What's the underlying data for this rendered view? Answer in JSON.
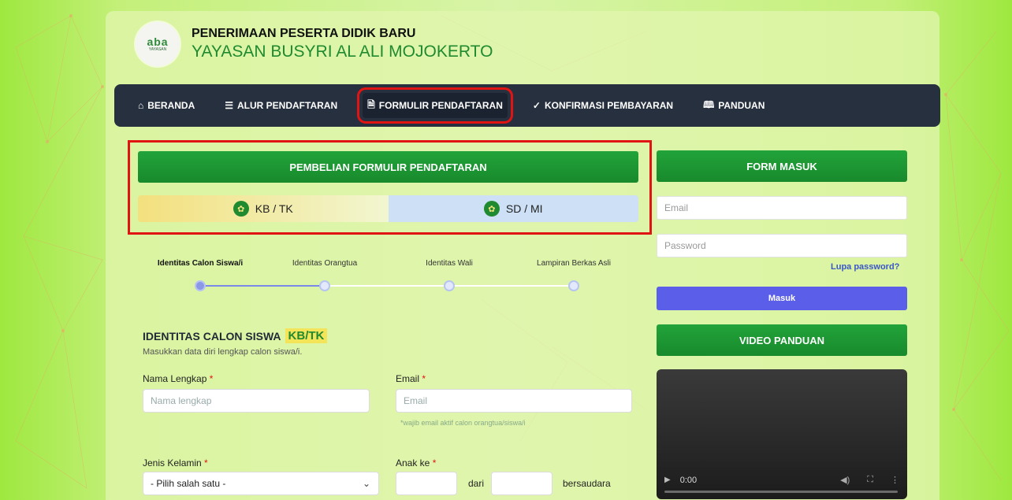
{
  "header": {
    "logo_mark": "aba",
    "logo_text": "YAYASAN",
    "title_line1": "PENERIMAAN PESERTA DIDIK BARU",
    "title_line2": "YAYASAN BUSYRI AL ALI MOJOKERTO"
  },
  "nav": [
    {
      "icon": "home-icon",
      "glyph": "⌂",
      "label": "BERANDA"
    },
    {
      "icon": "list-icon",
      "glyph": "☰",
      "label": "ALUR PENDAFTARAN"
    },
    {
      "icon": "document-icon",
      "glyph": "🗎",
      "label": "FORMULIR PENDAFTARAN",
      "active": true
    },
    {
      "icon": "check-icon",
      "glyph": "✓",
      "label": "KONFIRMASI PEMBAYARAN"
    },
    {
      "icon": "book-icon",
      "glyph": "🕮",
      "label": "PANDUAN"
    }
  ],
  "purchase": {
    "title": "PEMBELIAN FORMULIR PENDAFTARAN",
    "tabs": [
      {
        "label": "KB / TK"
      },
      {
        "label": "SD / MI"
      }
    ]
  },
  "steps": [
    {
      "label": "Identitas Calon Siswa/i",
      "active": true
    },
    {
      "label": "Identitas Orangtua"
    },
    {
      "label": "Identitas Wali"
    },
    {
      "label": "Lampiran Berkas Asli"
    }
  ],
  "form": {
    "section_title": "IDENTITAS CALON SISWA",
    "section_badge": "KB/TK",
    "section_subtitle": "Masukkan data diri lengkap calon siswa/i.",
    "nama_label": "Nama Lengkap",
    "nama_placeholder": "Nama lengkap",
    "email_label": "Email",
    "email_placeholder": "Email",
    "email_hint": "*wajib email aktif calon orangtua/siswa/i",
    "gender_label": "Jenis Kelamin",
    "gender_selected": "- Pilih salah satu -",
    "anak_label": "Anak ke",
    "dari_label": "dari",
    "bersaudara_label": "bersaudara",
    "required_mark": "*"
  },
  "login": {
    "title": "FORM MASUK",
    "email_placeholder": "Email",
    "password_placeholder": "Password",
    "forgot": "Lupa password?",
    "submit": "Masuk"
  },
  "video": {
    "title": "VIDEO PANDUAN",
    "time": "0:00"
  }
}
